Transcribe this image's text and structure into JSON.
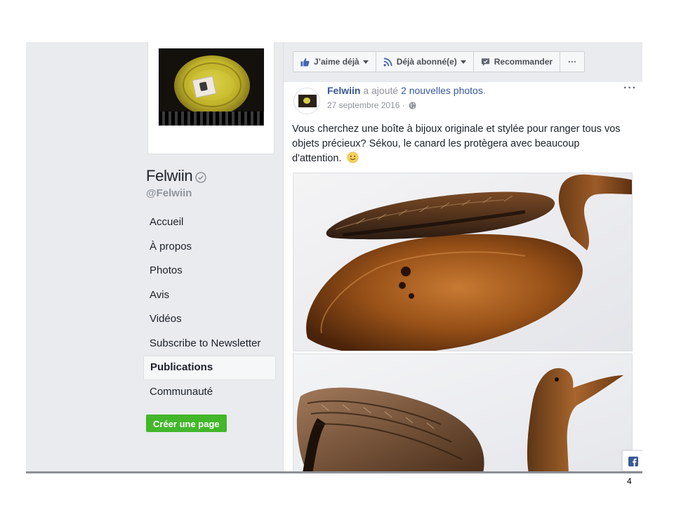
{
  "page": {
    "name": "Felwiin",
    "handle": "@Felwiin"
  },
  "nav": {
    "items": [
      {
        "label": "Accueil"
      },
      {
        "label": "À propos"
      },
      {
        "label": "Photos"
      },
      {
        "label": "Avis"
      },
      {
        "label": "Vidéos"
      },
      {
        "label": "Subscribe to Newsletter"
      },
      {
        "label": "Publications",
        "active": true
      },
      {
        "label": "Communauté"
      }
    ],
    "create_page": "Créer une page"
  },
  "actions": {
    "like": "J’aime déjà",
    "follow": "Déjà abonné(e)",
    "recommend": "Recommander",
    "more": "···"
  },
  "post": {
    "author": "Felwiin",
    "verb": "a ajouté",
    "object": "2 nouvelles photos",
    "punct": ".",
    "date": "27 septembre 2016 ·",
    "options": "···",
    "text": "Vous cherchez une boîte à bijoux originale et stylée pour ranger tous vos objets précieux? Sékou, le canard les protègera avec beaucoup d'attention.",
    "photos": [
      "wooden-duck-box-open",
      "wooden-duck-box-closed"
    ]
  },
  "slide": {
    "page_number": "4"
  },
  "colors": {
    "fb_blue": "#365899",
    "green": "#42b72a",
    "bg": "#e9ebee"
  }
}
